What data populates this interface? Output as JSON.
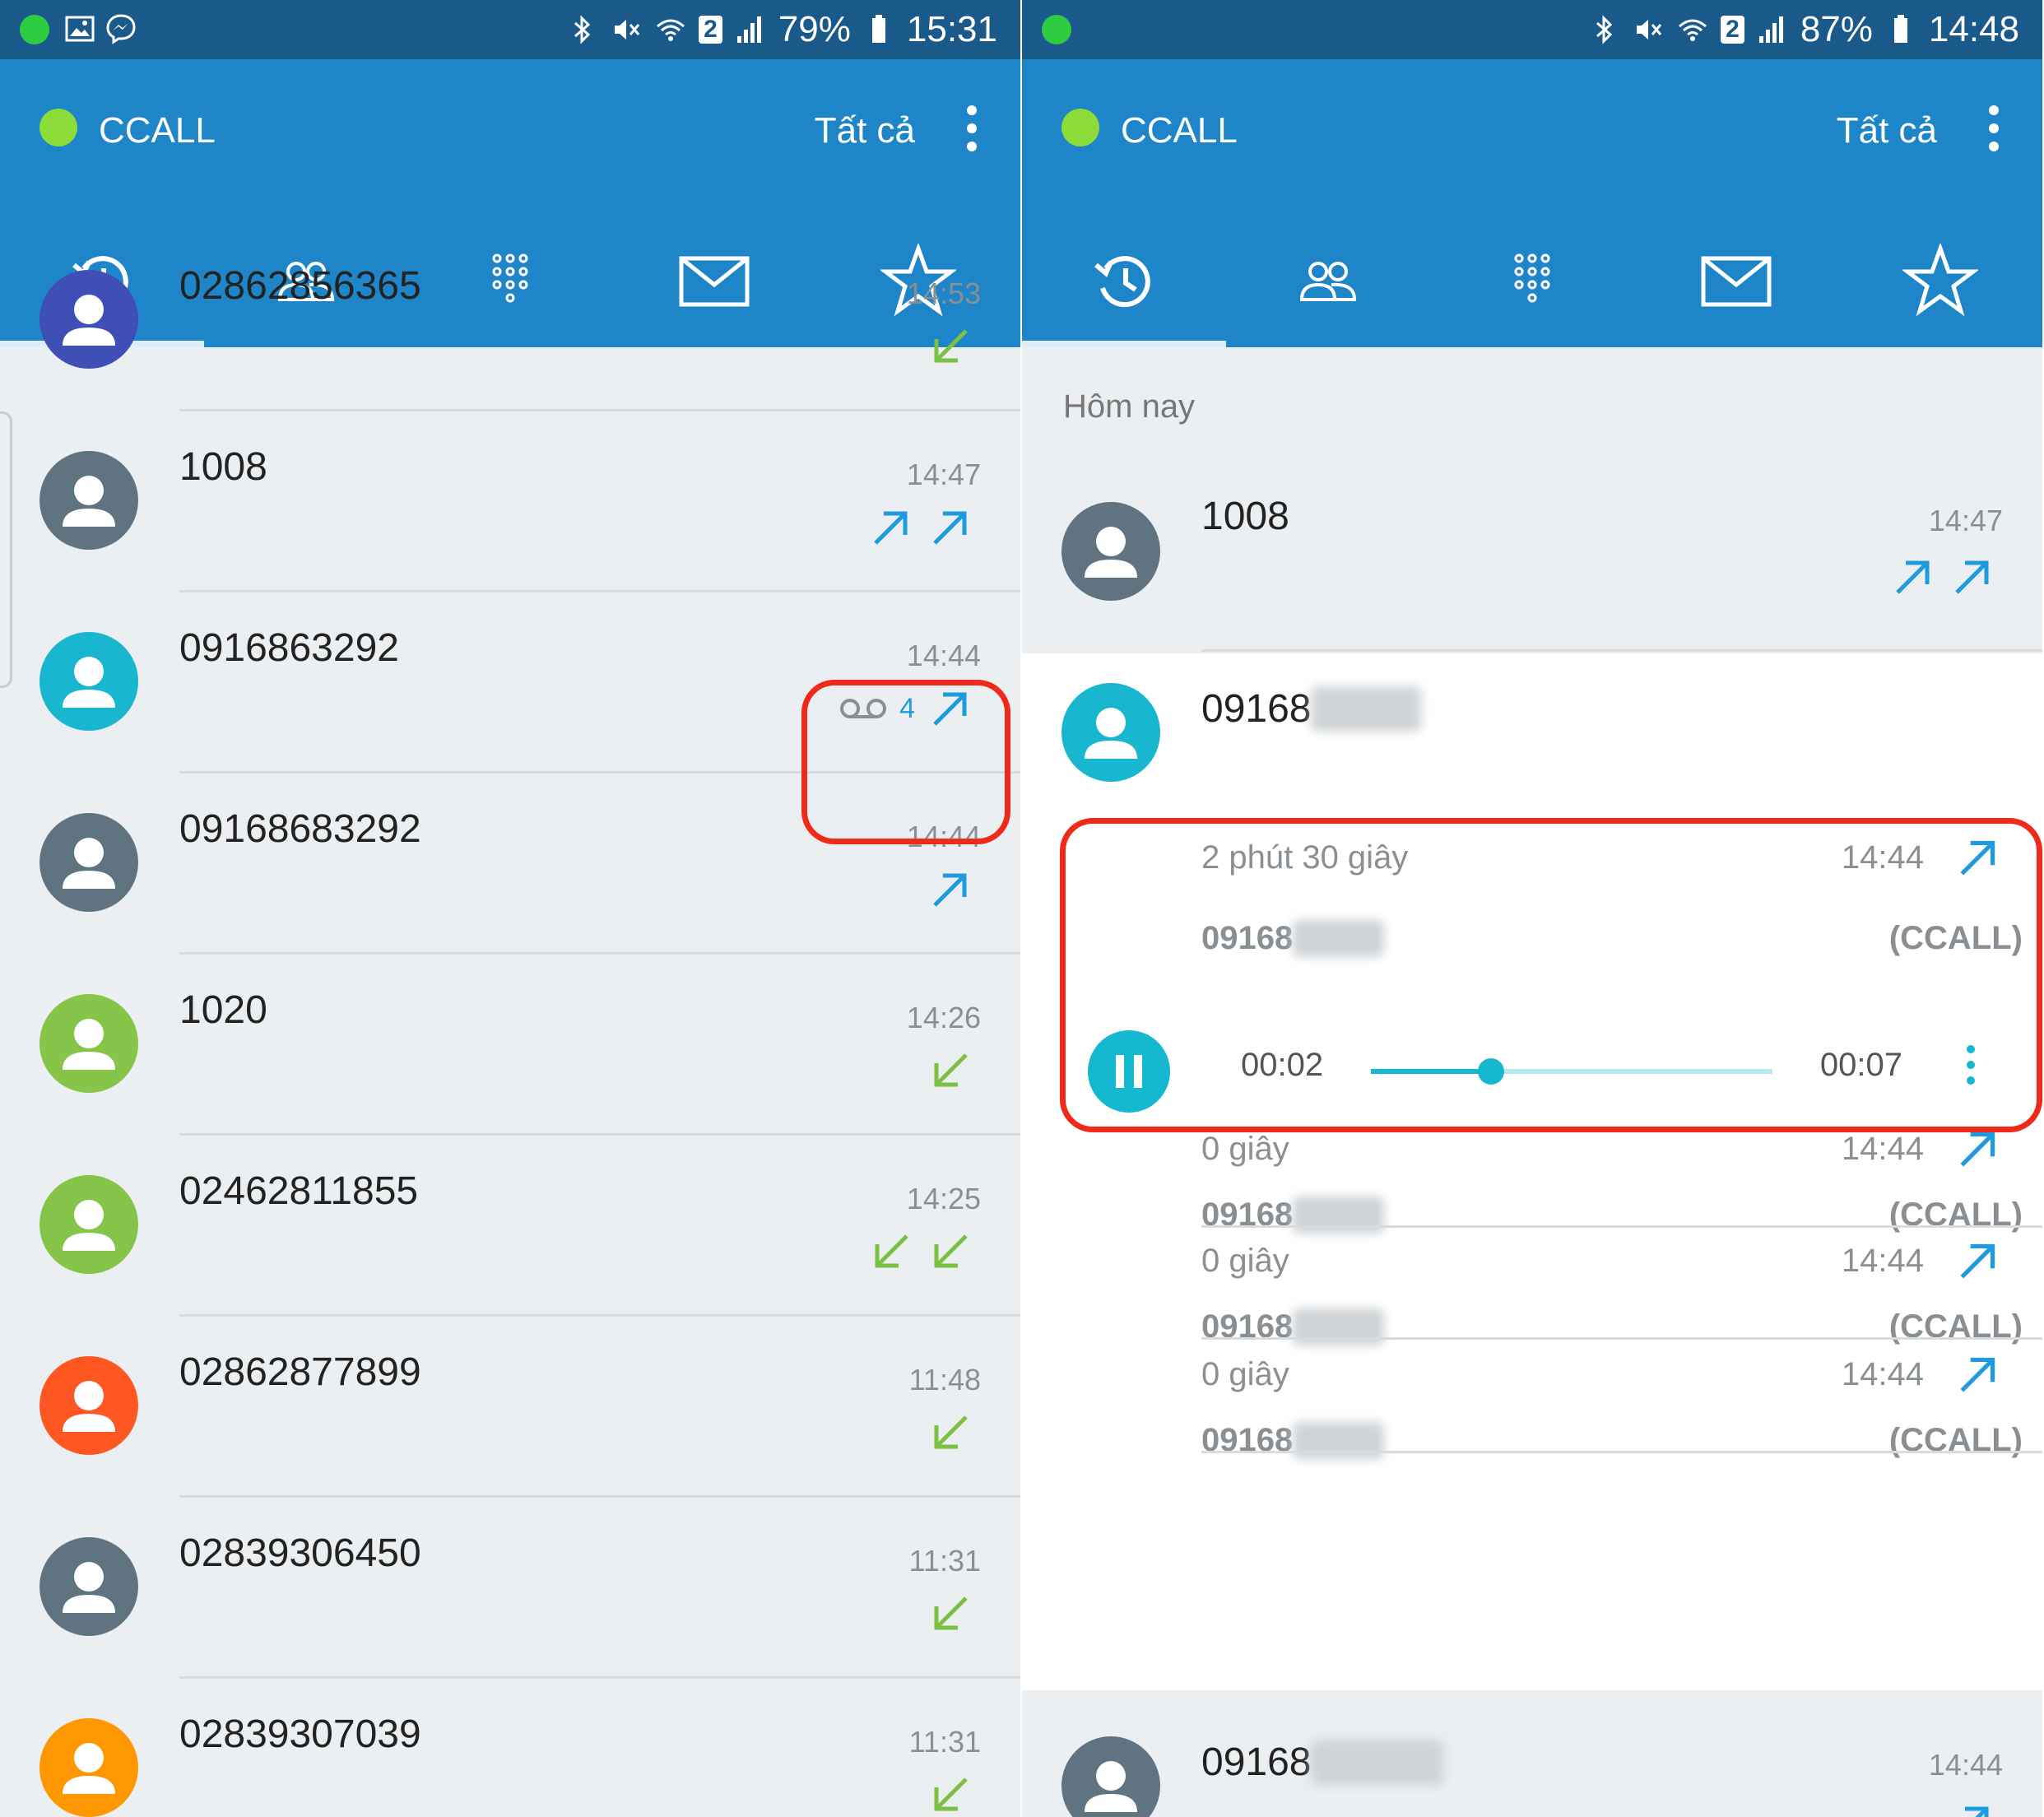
{
  "colors": {
    "statusbar": "#1a5a8a",
    "appbar": "#1e86c8",
    "accent": "#1e9be0",
    "incoming": "#7cc142",
    "highlight": "#ee2a1b",
    "player": "#14b8cf"
  },
  "left": {
    "status": {
      "battery": "79%",
      "time": "15:31",
      "sim": "2"
    },
    "app": {
      "title": "CCALL",
      "filter": "Tất cả"
    },
    "tabs": [
      "history-icon",
      "contacts-icon",
      "dialpad-icon",
      "message-icon",
      "star-icon"
    ],
    "calls": [
      {
        "number": "02862856365",
        "time": "14:53",
        "dirs": [
          "incoming"
        ],
        "avatar": "#3f4fb5"
      },
      {
        "number": "1008",
        "time": "14:47",
        "dirs": [
          "outgoing",
          "outgoing"
        ],
        "avatar": "#5f7380"
      },
      {
        "number": "0916863292",
        "time": "14:44",
        "dirs": [
          "outgoing"
        ],
        "avatar": "#18b6cf",
        "voicemail_count": "4"
      },
      {
        "number": "09168683292",
        "time": "14:44",
        "dirs": [
          "outgoing"
        ],
        "avatar": "#5f7380"
      },
      {
        "number": "1020",
        "time": "14:26",
        "dirs": [
          "incoming"
        ],
        "avatar": "#86c44a"
      },
      {
        "number": "02462811855",
        "time": "14:25",
        "dirs": [
          "incoming",
          "incoming"
        ],
        "avatar": "#86c44a"
      },
      {
        "number": "02862877899",
        "time": "11:48",
        "dirs": [
          "incoming"
        ],
        "avatar": "#ff5722"
      },
      {
        "number": "02839306450",
        "time": "11:31",
        "dirs": [
          "incoming"
        ],
        "avatar": "#5f7380"
      },
      {
        "number": "02839307039",
        "time": "11:31",
        "dirs": [
          "incoming"
        ],
        "avatar": "#ff9800"
      }
    ]
  },
  "right": {
    "status": {
      "battery": "87%",
      "time": "14:48",
      "sim": "2"
    },
    "app": {
      "title": "CCALL",
      "filter": "Tất cả"
    },
    "section": "Hôm nay",
    "call_1008": {
      "number": "1008",
      "time": "14:47"
    },
    "expanded": {
      "number_prefix": "09168",
      "number_hidden": "63292",
      "recordings": [
        {
          "duration": "2 phút 30 giây",
          "time": "14:44",
          "number_prefix": "09168",
          "number_hidden": "63292",
          "line": "(CCALL)"
        },
        {
          "duration": "0 giây",
          "time": "14:44",
          "number_prefix": "09168",
          "number_hidden": "63292",
          "line": "(CCALL)"
        },
        {
          "duration": "0 giây",
          "time": "14:44",
          "number_prefix": "09168",
          "number_hidden": "63292",
          "line": "(CCALL)"
        },
        {
          "duration": "0 giây",
          "time": "14:44",
          "number_prefix": "09168",
          "number_hidden": "63292",
          "line": "(CCALL)"
        }
      ],
      "player": {
        "current": "00:02",
        "total": "00:07",
        "progress": 0.3
      }
    },
    "last_call": {
      "number_prefix": "09168",
      "number_hidden": "683292",
      "time": "14:44"
    }
  }
}
